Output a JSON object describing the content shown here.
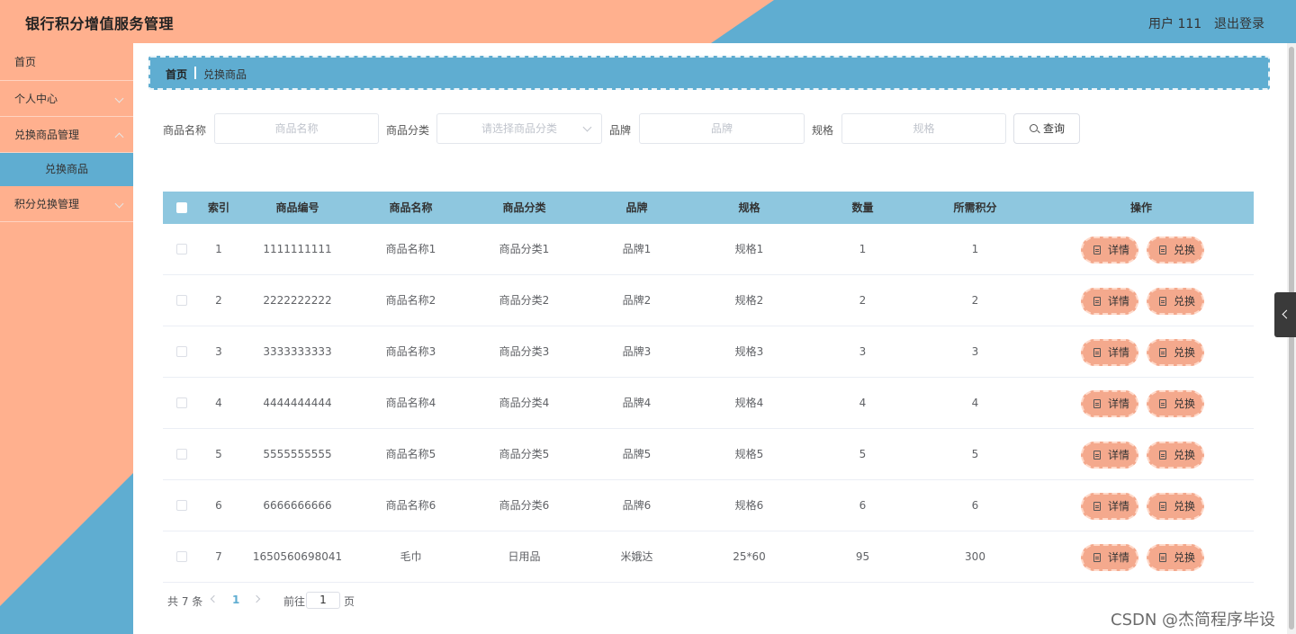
{
  "header": {
    "title": "银行积分增值服务管理",
    "user": "用户 111",
    "logout": "退出登录"
  },
  "colors": {
    "peach": "#ffb08e",
    "blue": "#5fadd1",
    "table_head": "#8ec7df",
    "row_button": "#f4a98d"
  },
  "sidebar": {
    "items": [
      {
        "label": "首页"
      },
      {
        "label": "个人中心"
      },
      {
        "label": "兑换商品管理"
      },
      {
        "label": "兑换商品",
        "active": true
      },
      {
        "label": "积分兑换管理"
      }
    ]
  },
  "breadcrumb": {
    "home": "首页",
    "current": "兑换商品"
  },
  "search": {
    "name_label": "商品名称",
    "name_placeholder": "商品名称",
    "category_label": "商品分类",
    "category_placeholder": "请选择商品分类",
    "brand_label": "品牌",
    "brand_placeholder": "品牌",
    "spec_label": "规格",
    "spec_placeholder": "规格",
    "query_label": "查询"
  },
  "table": {
    "headers": [
      "索引",
      "商品编号",
      "商品名称",
      "商品分类",
      "品牌",
      "规格",
      "数量",
      "所需积分",
      "操作"
    ],
    "detail_label": "详情",
    "exchange_label": "兑换",
    "rows": [
      [
        "1",
        "1111111111",
        "商品名称1",
        "商品分类1",
        "品牌1",
        "规格1",
        "1",
        "1"
      ],
      [
        "2",
        "2222222222",
        "商品名称2",
        "商品分类2",
        "品牌2",
        "规格2",
        "2",
        "2"
      ],
      [
        "3",
        "3333333333",
        "商品名称3",
        "商品分类3",
        "品牌3",
        "规格3",
        "3",
        "3"
      ],
      [
        "4",
        "4444444444",
        "商品名称4",
        "商品分类4",
        "品牌4",
        "规格4",
        "4",
        "4"
      ],
      [
        "5",
        "5555555555",
        "商品名称5",
        "商品分类5",
        "品牌5",
        "规格5",
        "5",
        "5"
      ],
      [
        "6",
        "6666666666",
        "商品名称6",
        "商品分类6",
        "品牌6",
        "规格6",
        "6",
        "6"
      ],
      [
        "7",
        "1650560698041",
        "毛巾",
        "日用品",
        "米娥达",
        "25*60",
        "95",
        "300"
      ]
    ]
  },
  "pagination": {
    "total": "共 7 条",
    "current_page": "1",
    "goto_label": "前往",
    "goto_value": "1",
    "page_suffix": "页"
  },
  "watermark": "CSDN @杰简程序毕设"
}
